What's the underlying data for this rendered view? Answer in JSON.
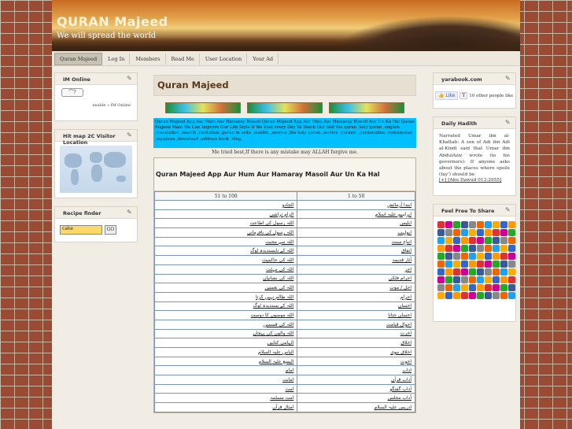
{
  "site": {
    "title": "QURAN Majeed",
    "tagline": "We will spread the world"
  },
  "nav": [
    {
      "label": "Quran Majeed",
      "active": true
    },
    {
      "label": "Log In"
    },
    {
      "label": "Members"
    },
    {
      "label": "Read Me"
    },
    {
      "label": "User Location"
    },
    {
      "label": "Your Ad"
    }
  ],
  "left": {
    "im_online": {
      "title": "IM Online",
      "badge": "?",
      "links": "enable » IM Online"
    },
    "hitmap": {
      "title": "Hit map 2C Visitor Location"
    },
    "recipe": {
      "title": "Recipe finder",
      "input_value": "cake",
      "go_label": "GO"
    }
  },
  "main": {
    "title": "Quran Majeed",
    "info_text": "Quran Majeed App Aur Hum Aur Hamaray Masoil Quran Majeed App Aur Hum Aur Hamaray Masoil Aur Un Ka Hal Quran Majeed Main We Can Improve Our Life Style If We Visit every Day To Teach Our Self the quran ,holy quran ,english ,translation ,search ,recitation ,quran in urdu ,muslim ,service ,the holy quran ,service ,quranic ,quranonline ,mohammad ,myquran ,download ,address book ,blog,",
    "tried_line": "Me tried best,If there is any mistake may ALLAH forgive me.",
    "table_title": "Quran Majeed App Aur Hum Aur Hamaray Masoil Aur Un Ka Hal",
    "col_headers": [
      "51 to 100",
      "1 to 50"
    ],
    "rows": [
      [
        "الجادو",
        "ابتدا آزمائش"
      ],
      [
        "الزام تراشی",
        "ابراہیم علیہ اسلام"
      ],
      [
        "اللہ رسول کی اطاعت",
        "ابلیس"
      ],
      [
        "اللہ رسول کی نافرمانی",
        "ابولہب"
      ],
      [
        "اللہ سے محبت",
        "اتباع سنت"
      ],
      [
        "اللہ کے ناپسندیدہ لوگ",
        "اتفاق"
      ],
      [
        "اللہ کی حاکمیت",
        "آثار قدیمہ"
      ],
      [
        "اللہ کی مہلت",
        "اجر"
      ],
      [
        "اللہ کی نشانیاں",
        "اجرام فلکی"
      ],
      [
        "اللہ کی نعمتیں",
        "اجل / موت"
      ],
      [
        "اللہ ظالم نہیں کرتا",
        "احرام"
      ],
      [
        "اللہ کے پسندیدہ لوگ",
        "احسان"
      ],
      [
        "اللہ مومنوں کا دوست",
        "احسان جتانا"
      ],
      [
        "اللہ کی قسمیں",
        "احوال قیامت"
      ],
      [
        "اللہ والوں کی پہچان",
        "اخرت"
      ],
      [
        "الہامی کتابیں",
        "اخلاق"
      ],
      [
        "الیاس علیہ السلام",
        "اخلاق نبوی"
      ],
      [
        "الیسع علیہ السلام",
        "اخوت"
      ],
      [
        "امام",
        "اداب"
      ],
      [
        "امانت",
        "آداب قرآن"
      ],
      [
        "امت",
        "آداب گفتگو"
      ],
      [
        "امت مسلمہ",
        "آداب مجلس"
      ],
      [
        "امثال قرآن",
        "ادریس علیہ السلام"
      ]
    ]
  },
  "right": {
    "yarabook": {
      "title": "yarabook.com",
      "like_label": "Like",
      "y_label": "Y",
      "others_text": "10 other people like"
    },
    "hadith": {
      "title": "Daily Hadith",
      "text": "Narrated Umar ibn al-Khattab: A son of Adi ibn Adi al-Kindi said that Umar ibn AbdulAziz wrote (to his governors): If anyone asks about the places where spoils (fay') should be",
      "link": "[+] [Abu Dawud 013:2955]"
    },
    "share": {
      "title": "Feel Free To Share"
    }
  },
  "colors": {
    "info_box": "#00bfff",
    "share_icons": [
      "#d33",
      "#3b5998",
      "#1da1f2",
      "#f90",
      "#2a2",
      "#e60",
      "#36c",
      "#c09",
      "#888",
      "#fa0"
    ]
  }
}
